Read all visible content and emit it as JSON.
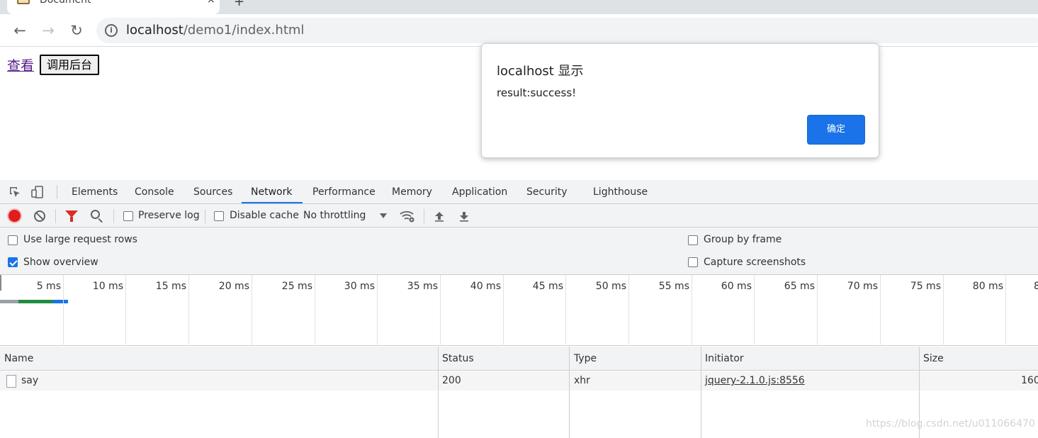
{
  "browser": {
    "tab_title": "Document",
    "tab_close": "×",
    "new_tab": "+",
    "url_host": "localhost",
    "url_path": "/demo1/index.html",
    "info_glyph": "i"
  },
  "page": {
    "link_text": "查看",
    "button_label": "调用后台"
  },
  "dialog": {
    "title": "localhost 显示",
    "message": "result:success!",
    "ok_label": "确定",
    "accent": "#1a73e8"
  },
  "devtools": {
    "tabs": [
      "Elements",
      "Console",
      "Sources",
      "Network",
      "Performance",
      "Memory",
      "Application",
      "Security",
      "Lighthouse"
    ],
    "active_tab": "Network",
    "toolbar": {
      "preserve_log": "Preserve log",
      "disable_cache": "Disable cache",
      "throttling": "No throttling"
    },
    "settings": {
      "use_large_rows": "Use large request rows",
      "show_overview": "Show overview",
      "group_by_frame": "Group by frame",
      "capture_screenshots": "Capture screenshots"
    },
    "timeline_labels": [
      "5 ms",
      "10 ms",
      "15 ms",
      "20 ms",
      "25 ms",
      "30 ms",
      "35 ms",
      "40 ms",
      "45 ms",
      "50 ms",
      "55 ms",
      "60 ms",
      "65 ms",
      "70 ms",
      "75 ms",
      "80 ms",
      "8"
    ],
    "table": {
      "headers": [
        "Name",
        "Status",
        "Type",
        "Initiator",
        "Size"
      ],
      "rows": [
        {
          "name": "say",
          "status": "200",
          "type": "xhr",
          "initiator": "jquery-2.1.0.js:8556",
          "size": "160"
        }
      ]
    }
  },
  "watermark": "https://blog.csdn.net/u011066470"
}
